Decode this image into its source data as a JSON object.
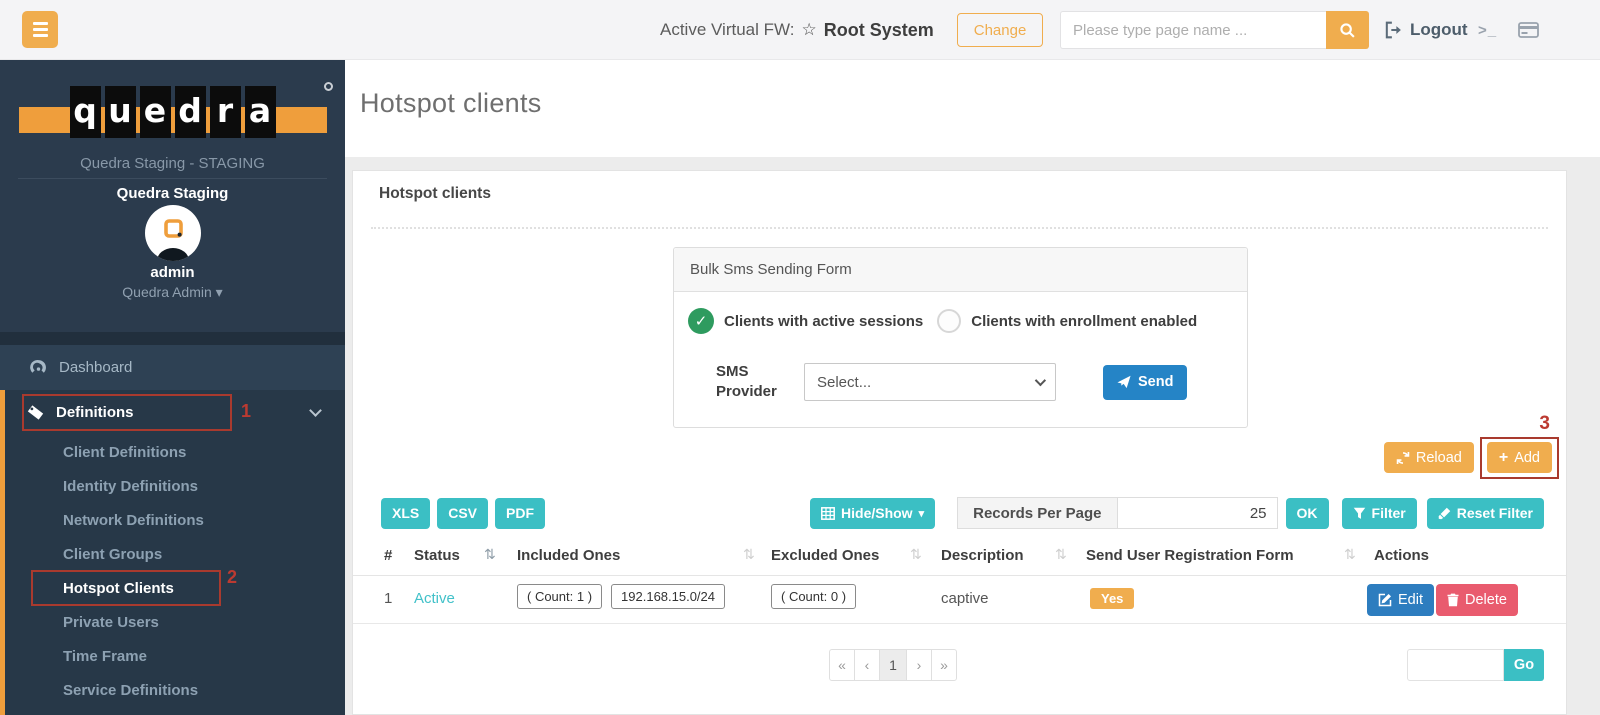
{
  "colors": {
    "accent_orange": "#f0ad4e",
    "teal": "#3bbfc4",
    "blue": "#2584c6",
    "edit_blue": "#2d7dbf",
    "delete_red": "#e95b6e",
    "green": "#2e9b5f",
    "sidebar_bg": "#2b3b4d",
    "annotation_red": "#bc3a31"
  },
  "icons": {
    "star": "☆",
    "caret_down": "▾",
    "check": "✓",
    "terminal": ">_",
    "sort": "⇅",
    "plus": "+"
  },
  "topbar": {
    "active_fw_label": "Active Virtual FW:",
    "active_fw_name": "Root System",
    "change_button": "Change",
    "search_placeholder": "Please type page name ...",
    "logout_label": "Logout"
  },
  "sidebar": {
    "logo_letters": [
      "q",
      "u",
      "e",
      "d",
      "r",
      "a"
    ],
    "tenant": "Quedra Staging - STAGING",
    "org_name": "Quedra Staging",
    "username": "admin",
    "role": "Quedra Admin",
    "menu": {
      "dashboard": "Dashboard",
      "definitions": "Definitions"
    },
    "submenu": [
      "Client Definitions",
      "Identity Definitions",
      "Network Definitions",
      "Client Groups",
      "Hotspot Clients",
      "Private Users",
      "Time Frame",
      "Service Definitions"
    ]
  },
  "annotations": {
    "step1": "1",
    "step2": "2",
    "step3": "3"
  },
  "page": {
    "title": "Hotspot clients"
  },
  "panel": {
    "title": "Hotspot clients"
  },
  "bulk_form": {
    "title": "Bulk Sms Sending Form",
    "option_active_sessions": "Clients with active sessions",
    "option_enrollment": "Clients with enrollment enabled",
    "provider_label": "SMS Provider",
    "provider_value": "Select...",
    "send_button": "Send"
  },
  "list_actions": {
    "reload_button": "Reload",
    "add_button": "Add"
  },
  "toolbar": {
    "export_buttons": [
      "XLS",
      "CSV",
      "PDF"
    ],
    "hide_show_button": "Hide/Show",
    "records_per_page_label": "Records Per Page",
    "records_per_page_value": "25",
    "ok_button": "OK",
    "filter_button": "Filter",
    "reset_filter_button": "Reset Filter"
  },
  "table": {
    "columns": [
      "#",
      "Status",
      "Included Ones",
      "Excluded Ones",
      "Description",
      "Send User Registration Form",
      "Actions"
    ],
    "row": {
      "index": "1",
      "status": "Active",
      "included_count": "( Count: 1 )",
      "included_network": "192.168.15.0/24",
      "excluded_count": "( Count: 0 )",
      "description": "captive",
      "send_user_registration_form": "Yes",
      "edit_button": "Edit",
      "delete_button": "Delete"
    }
  },
  "pagination": {
    "first": "«",
    "prev": "‹",
    "current": "1",
    "next": "›",
    "last": "»",
    "go_button": "Go"
  }
}
